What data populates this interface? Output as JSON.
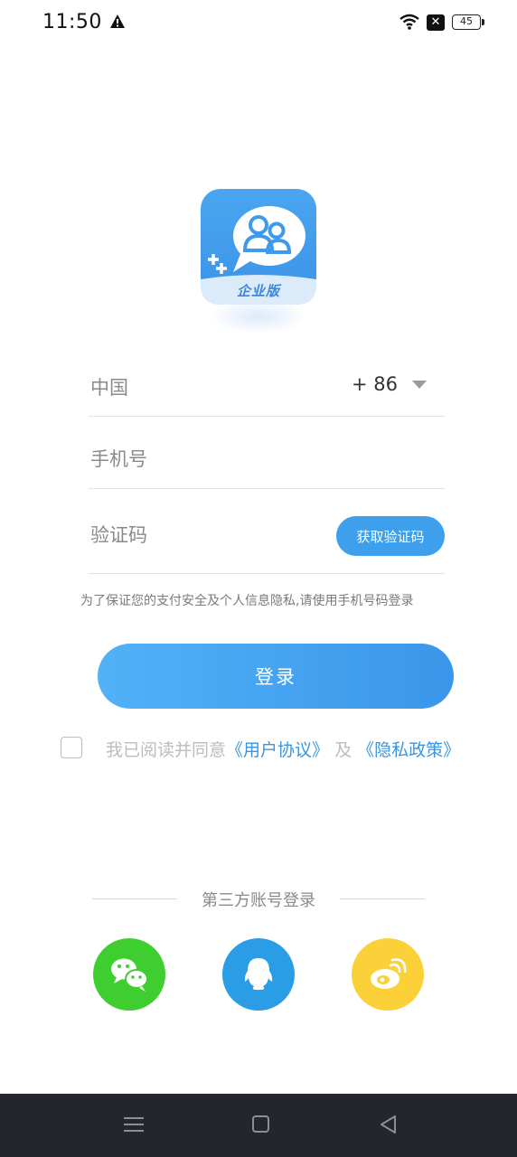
{
  "status_bar": {
    "time": "11:50",
    "battery": "45",
    "icons": [
      "warning-icon",
      "wifi-icon",
      "sim-off-icon",
      "battery-icon"
    ]
  },
  "logo": {
    "badge_text": "企业版",
    "brand_blue": "#3d9aec"
  },
  "form": {
    "country_name": "中国",
    "country_code": "+ 86",
    "phone_placeholder": "手机号",
    "code_placeholder": "验证码",
    "get_code_label": "获取验证码"
  },
  "hint": "为了保证您的支付安全及个人信息隐私,请使用手机号码登录",
  "login_label": "登录",
  "agreement": {
    "prefix": "我已阅读并同意",
    "user_agreement": "《用户协议》",
    "connector": " 及 ",
    "privacy_policy": "《隐私政策》",
    "checked": false
  },
  "third_party": {
    "title": "第三方账号登录",
    "providers": [
      "wechat",
      "qq",
      "weibo"
    ]
  },
  "colors": {
    "accent": "#3a96ea",
    "wechat": "#3fce2f",
    "qq": "#2b9de6",
    "weibo": "#fcd038"
  }
}
